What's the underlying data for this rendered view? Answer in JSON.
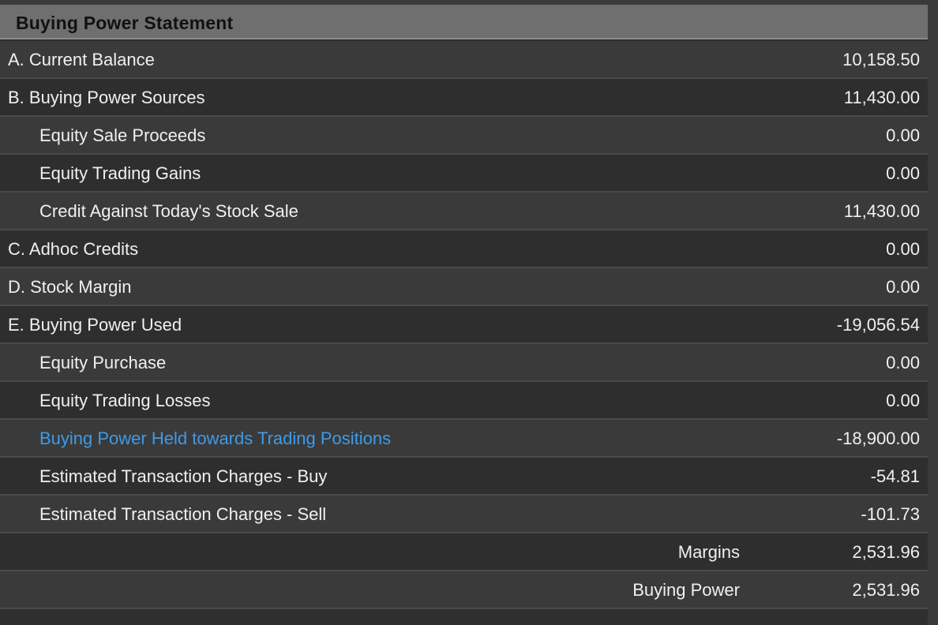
{
  "header": {
    "title": "Buying Power Statement"
  },
  "rows": [
    {
      "label": "A. Current Balance",
      "value": "10,158.50"
    },
    {
      "label": "B. Buying Power Sources",
      "value": "11,430.00"
    },
    {
      "label": "Equity Sale Proceeds",
      "value": "0.00"
    },
    {
      "label": "Equity Trading Gains",
      "value": "0.00"
    },
    {
      "label": "Credit Against Today's Stock Sale",
      "value": "11,430.00"
    },
    {
      "label": "C. Adhoc Credits",
      "value": "0.00"
    },
    {
      "label": "D. Stock Margin",
      "value": "0.00"
    },
    {
      "label": "E. Buying Power Used",
      "value": "-19,056.54"
    },
    {
      "label": "Equity Purchase",
      "value": "0.00"
    },
    {
      "label": "Equity Trading Losses",
      "value": "0.00"
    },
    {
      "label": "Buying Power Held towards Trading Positions",
      "value": "-18,900.00"
    },
    {
      "label": "Estimated Transaction Charges - Buy",
      "value": "-54.81"
    },
    {
      "label": "Estimated Transaction Charges - Sell",
      "value": "-101.73"
    }
  ],
  "summary": [
    {
      "label": "Margins",
      "value": "2,531.96"
    },
    {
      "label": "Buying Power",
      "value": "2,531.96"
    }
  ],
  "colors": {
    "link": "#3d9be9",
    "header_bg": "#6f6f6f"
  }
}
